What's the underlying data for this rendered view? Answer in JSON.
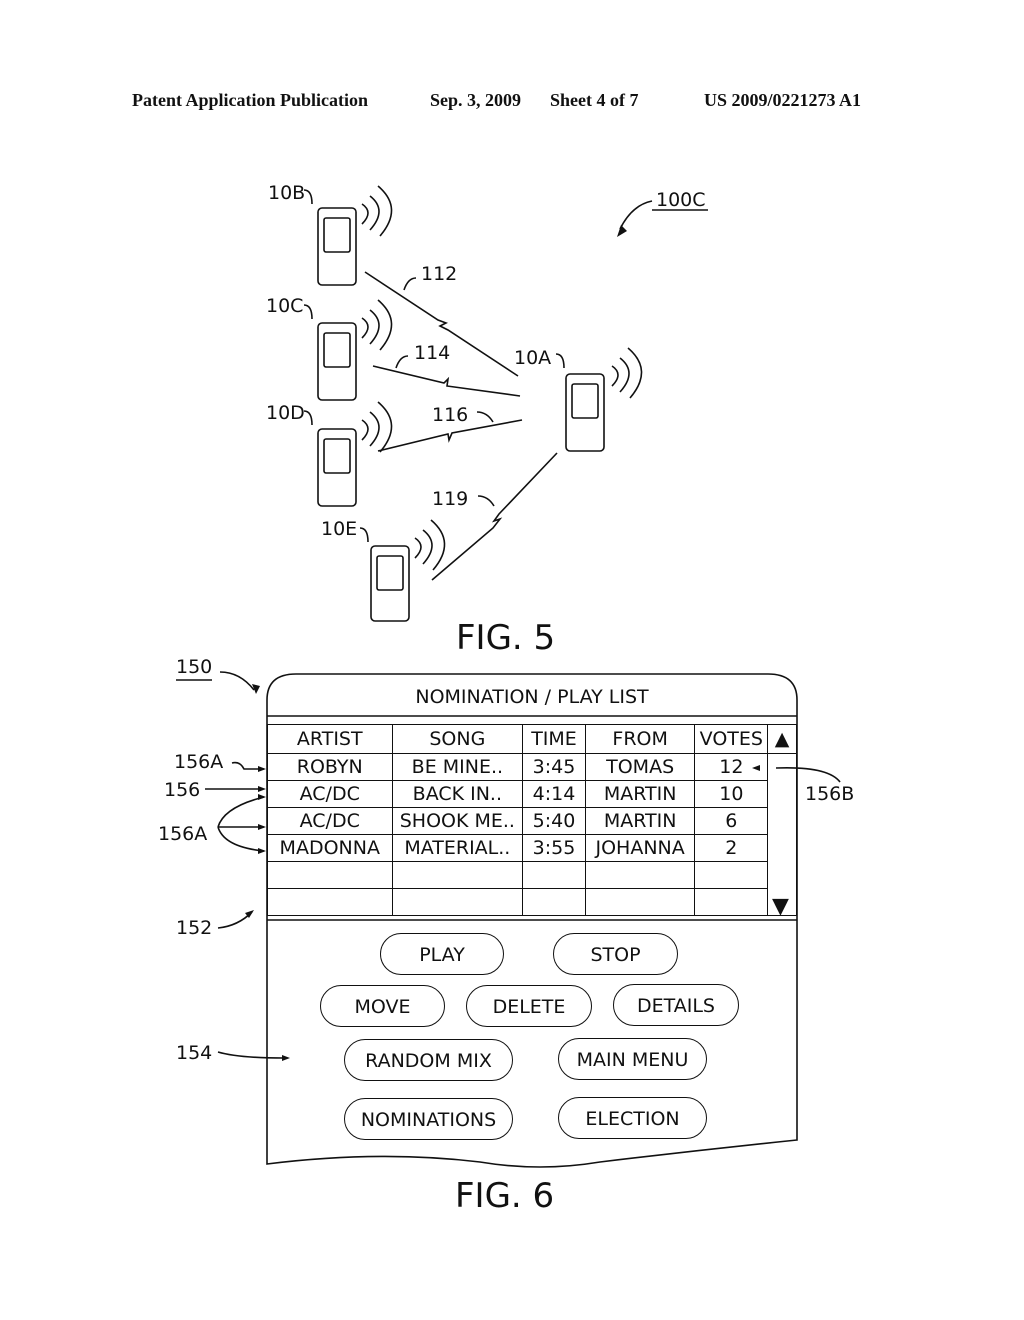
{
  "header": {
    "publication": "Patent Application Publication",
    "date": "Sep. 3, 2009",
    "sheet": "Sheet 4 of 7",
    "number": "US 2009/0221273 A1"
  },
  "fig5": {
    "caption": "FIG. 5",
    "system_label": "100C",
    "devices": [
      {
        "id": "10A"
      },
      {
        "id": "10B"
      },
      {
        "id": "10C"
      },
      {
        "id": "10D"
      },
      {
        "id": "10E"
      }
    ],
    "links": [
      {
        "id": "112",
        "from": "10B",
        "to": "10A"
      },
      {
        "id": "114",
        "from": "10C",
        "to": "10A"
      },
      {
        "id": "116",
        "from": "10D",
        "to": "10A"
      },
      {
        "id": "119",
        "from": "10E",
        "to": "10A"
      }
    ]
  },
  "fig6": {
    "caption": "FIG. 6",
    "screen_label": "150",
    "title": "NOMINATION / PLAY LIST",
    "refs": {
      "list_area": "152",
      "button_area": "154",
      "entry": "156",
      "entry_a_top": "156A",
      "entry_a_group": "156A",
      "votes": "156B"
    },
    "columns": [
      "ARTIST",
      "SONG",
      "TIME",
      "FROM",
      "VOTES"
    ],
    "rows": [
      {
        "artist": "ROBYN",
        "song": "BE MINE..",
        "time": "3:45",
        "from": "TOMAS",
        "votes": "12"
      },
      {
        "artist": "AC/DC",
        "song": "BACK IN..",
        "time": "4:14",
        "from": "MARTIN",
        "votes": "10"
      },
      {
        "artist": "AC/DC",
        "song": "SHOOK ME..",
        "time": "5:40",
        "from": "MARTIN",
        "votes": "6"
      },
      {
        "artist": "MADONNA",
        "song": "MATERIAL..",
        "time": "3:55",
        "from": "JOHANNA",
        "votes": "2"
      },
      {
        "artist": "",
        "song": "",
        "time": "",
        "from": "",
        "votes": ""
      },
      {
        "artist": "",
        "song": "",
        "time": "",
        "from": "",
        "votes": ""
      }
    ],
    "scroll_up": "▲",
    "scroll_down": "▼",
    "buttons": {
      "play": "PLAY",
      "stop": "STOP",
      "move": "MOVE",
      "delete": "DELETE",
      "details": "DETAILS",
      "random_mix": "RANDOM MIX",
      "main_menu": "MAIN MENU",
      "nominations": "NOMINATIONS",
      "election": "ELECTION"
    }
  }
}
